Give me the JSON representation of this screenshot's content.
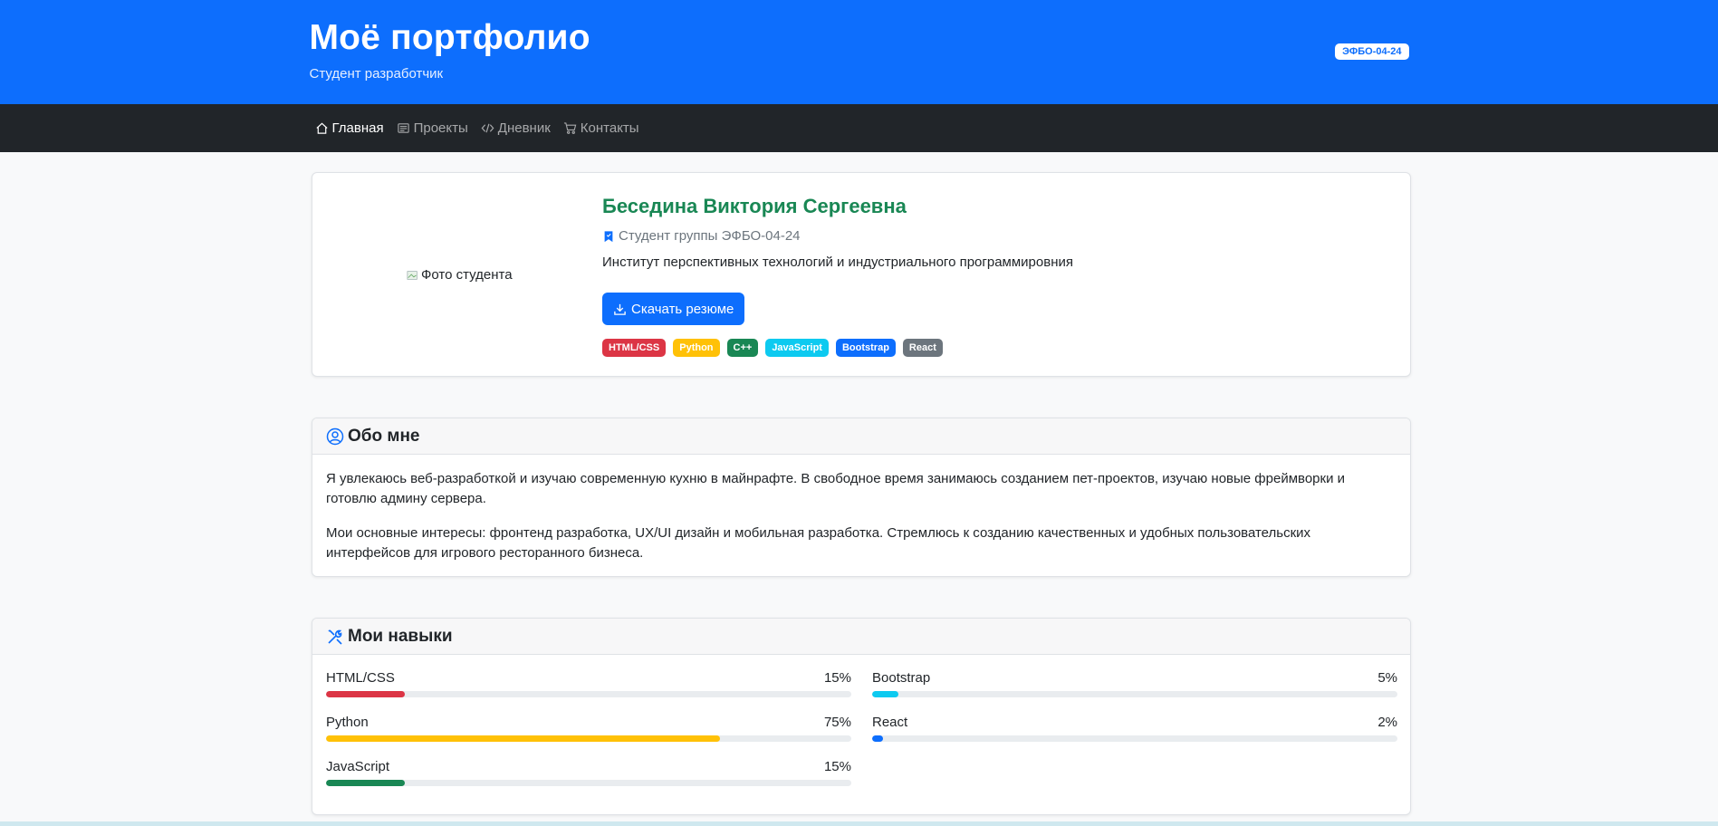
{
  "header": {
    "title": "Моё портфолио",
    "subtitle": "Студент разработчик",
    "group_badge": "ЭФБО-04-24",
    "accent_color": "#0d6efd"
  },
  "nav": {
    "items": [
      {
        "label": "Главная",
        "icon": "house-icon",
        "active": true
      },
      {
        "label": "Проекты",
        "icon": "newspaper-icon",
        "active": false
      },
      {
        "label": "Дневник",
        "icon": "code-icon",
        "active": false
      },
      {
        "label": "Контакты",
        "icon": "cart-icon",
        "active": false
      }
    ]
  },
  "profile": {
    "photo_alt": "Фото студента",
    "name": "Беседина Виктория Сергеевна",
    "group": "Студент группы ЭФБО-04-24",
    "institute": "Институт перспективных технологий и индустриального программировния",
    "resume_button": "Скачать резюме",
    "tags": [
      {
        "label": "HTML/CSS",
        "color": "#dc3545"
      },
      {
        "label": "Python",
        "color": "#ffc107"
      },
      {
        "label": "C++",
        "color": "#198754"
      },
      {
        "label": "JavaScript",
        "color": "#0dcaf0"
      },
      {
        "label": "Bootstrap",
        "color": "#0d6efd"
      },
      {
        "label": "React",
        "color": "#6c757d"
      }
    ]
  },
  "about": {
    "title": "Обо мне",
    "paragraphs": [
      "Я увлекаюсь веб-разработкой и изучаю современную кухню в майнрафте. В свободное время занимаюсь созданием пет-проектов, изучаю новые фреймворки и готовлю админу сервера.",
      "Мои основные интересы: фронтенд разработка, UX/UI дизайн и мобильная разработка. Стремлюсь к созданию качественных и удобных пользовательских интерфейсов для игрового ресторанного бизнеса."
    ]
  },
  "skills": {
    "title": "Мои навыки",
    "items": [
      {
        "name": "HTML/CSS",
        "percent_label": "15%",
        "value": 15,
        "color": "#dc3545"
      },
      {
        "name": "Bootstrap",
        "percent_label": "5%",
        "value": 5,
        "color": "#0dcaf0"
      },
      {
        "name": "Python",
        "percent_label": "75%",
        "value": 75,
        "color": "#ffc107"
      },
      {
        "name": "React",
        "percent_label": "2%",
        "value": 2,
        "color": "#0d6efd"
      },
      {
        "name": "JavaScript",
        "percent_label": "15%",
        "value": 15,
        "color": "#198754"
      }
    ]
  }
}
